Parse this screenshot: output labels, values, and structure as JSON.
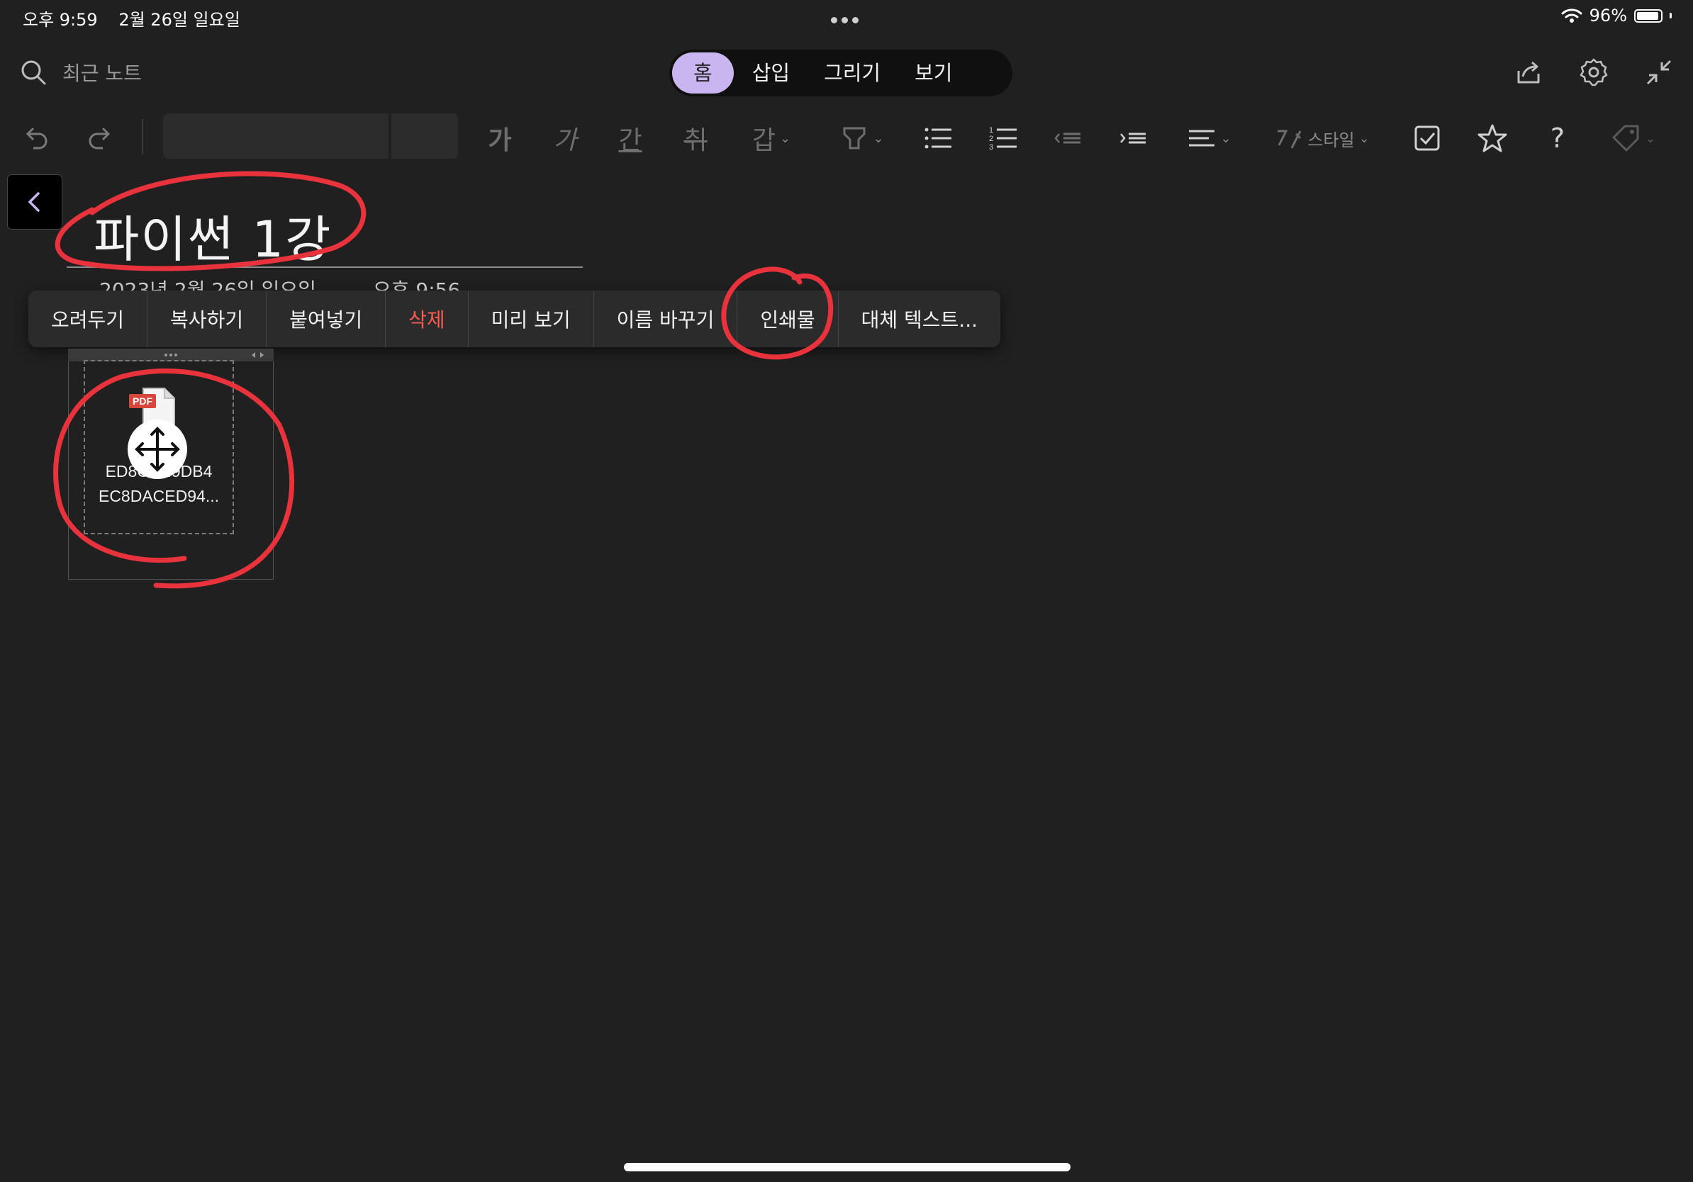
{
  "status_bar": {
    "time": "오후 9:59",
    "date": "2월 26일 일요일",
    "battery": "96%"
  },
  "search": {
    "label": "최근 노트"
  },
  "tabs": [
    {
      "label": "홈"
    },
    {
      "label": "삽입"
    },
    {
      "label": "그리기"
    },
    {
      "label": "보기"
    }
  ],
  "toolbar": {
    "bold_glyph": "가",
    "italic_glyph": "가",
    "underline_glyph": "간",
    "strike_glyph": "취",
    "highlight_glyph": "갑",
    "style_label": "스타일",
    "help_glyph": "?"
  },
  "page": {
    "title": "파이썬 1강",
    "date": "2023년 2월 26일 일요일",
    "time": "오후 9:56"
  },
  "context_menu": [
    {
      "label": "오려두기"
    },
    {
      "label": "복사하기"
    },
    {
      "label": "붙여넣기"
    },
    {
      "label": "삭제"
    },
    {
      "label": "미리 보기"
    },
    {
      "label": "이름 바꾸기"
    },
    {
      "label": "인쇄물"
    },
    {
      "label": "대체 텍스트..."
    }
  ],
  "attachment": {
    "badge": "PDF",
    "name_line1": "ED8C8...9DB4",
    "name_line2": "EC8DACED94..."
  },
  "colors": {
    "accent": "#c9b5f0",
    "danger": "#ff5a52",
    "annotation": "#e8323c"
  }
}
